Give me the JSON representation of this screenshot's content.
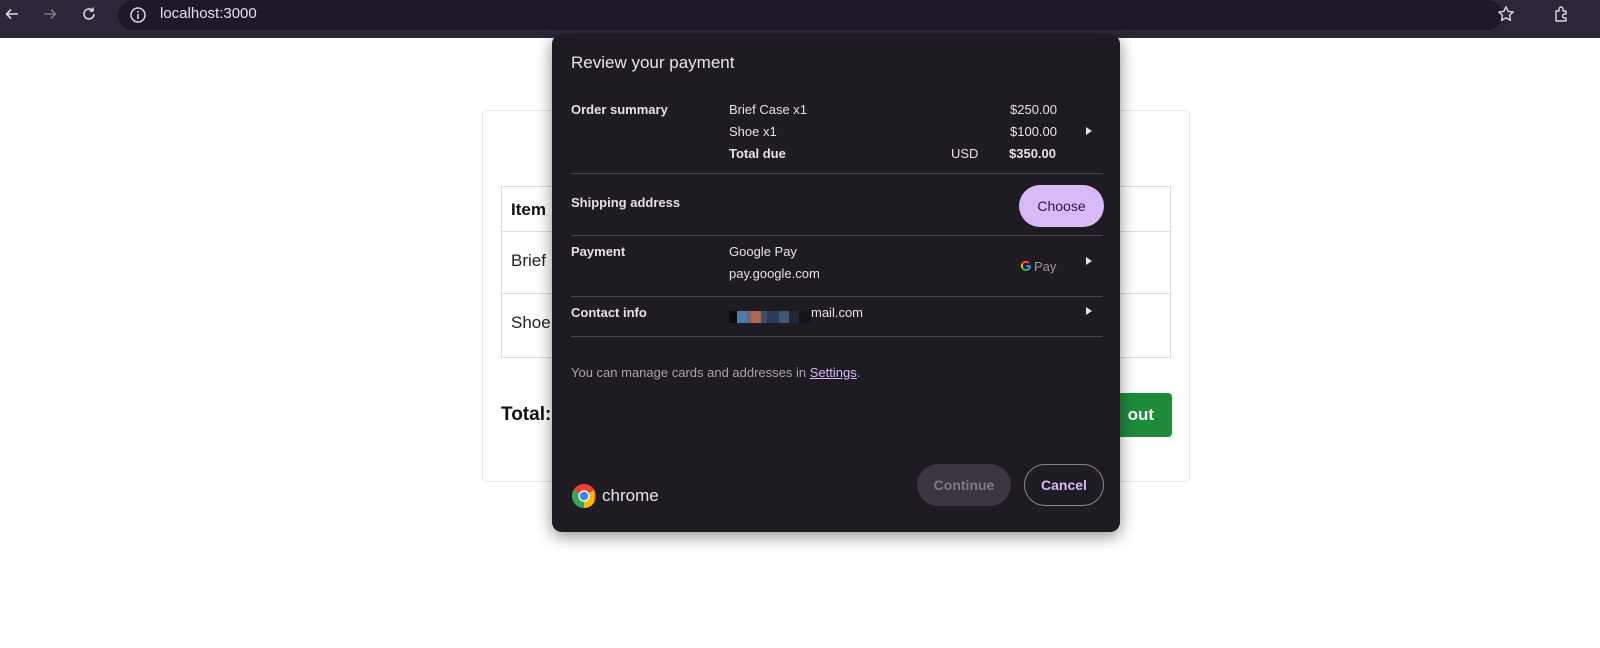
{
  "browser": {
    "url": "localhost:3000"
  },
  "page": {
    "table_header": "Item",
    "rows": [
      "Brief",
      "Shoe"
    ],
    "total_label": "Total:",
    "checkout_label": "out",
    "checkout_color": "#1e8b3a"
  },
  "dialog": {
    "title": "Review your payment",
    "order_summary": {
      "label": "Order summary",
      "items": [
        {
          "name": "Brief Case x1",
          "price": "$250.00"
        },
        {
          "name": "Shoe x1",
          "price": "$100.00"
        }
      ],
      "total_label": "Total due",
      "currency": "USD",
      "total": "$350.00"
    },
    "shipping": {
      "label": "Shipping address",
      "button": "Choose"
    },
    "payment": {
      "label": "Payment",
      "method": "Google Pay",
      "domain": "pay.google.com",
      "logo_text": "Pay"
    },
    "contact": {
      "label": "Contact info",
      "email_suffix": "mail.com"
    },
    "manage_text": "You can manage cards and addresses in ",
    "settings_link": "Settings",
    "manage_end": ".",
    "brand": "chrome",
    "continue_label": "Continue",
    "cancel_label": "Cancel",
    "accent_color": "#d9b9f7"
  }
}
